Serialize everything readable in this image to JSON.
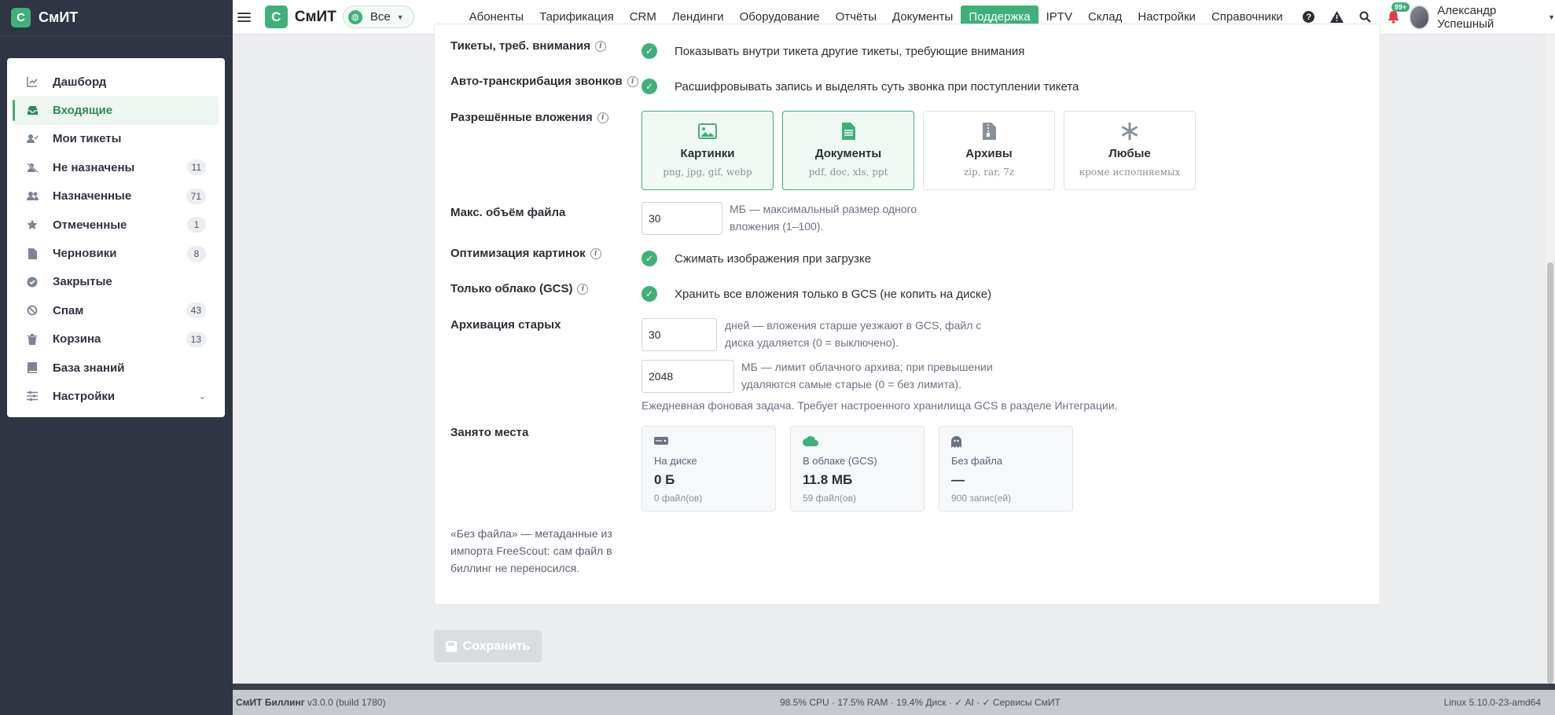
{
  "app": {
    "brand": "СмИТ",
    "logo_letter": "С"
  },
  "sidebar": {
    "items": [
      {
        "label": "Дашборд",
        "icon": "chart-icon"
      },
      {
        "label": "Входящие",
        "icon": "inbox-icon",
        "active": true
      },
      {
        "label": "Мои тикеты",
        "icon": "user-check-icon"
      },
      {
        "label": "Не назначены",
        "icon": "user-slash-icon",
        "count": "11"
      },
      {
        "label": "Назначенные",
        "icon": "users-icon",
        "count": "71"
      },
      {
        "label": "Отмеченные",
        "icon": "star-icon",
        "count": "1"
      },
      {
        "label": "Черновики",
        "icon": "file-icon",
        "count": "8"
      },
      {
        "label": "Закрытые",
        "icon": "check-circle-icon"
      },
      {
        "label": "Спам",
        "icon": "ban-icon",
        "count": "43"
      },
      {
        "label": "Корзина",
        "icon": "trash-icon",
        "count": "13"
      },
      {
        "label": "База знаний",
        "icon": "book-icon"
      },
      {
        "label": "Настройки",
        "icon": "sliders-icon"
      }
    ]
  },
  "topbar": {
    "scope": "Все",
    "nav": [
      "Абоненты",
      "Тарификация",
      "CRM",
      "Лендинги",
      "Оборудование",
      "Отчёты",
      "Документы",
      "Поддержка",
      "IPTV",
      "Склад",
      "Настройки",
      "Справочники"
    ],
    "active_nav": "Поддержка",
    "notifications": "99+",
    "user": "Александр Успешный"
  },
  "form": {
    "tickets_attention": {
      "label": "Тикеты, треб. внимания",
      "text": "Показывать внутри тикета другие тикеты, требующие внимания"
    },
    "transcription": {
      "label": "Авто-транскрибация звонков",
      "text": "Расшифровывать запись и выделять суть звонка при поступлении тикета"
    },
    "attachments": {
      "label": "Разрешённые вложения",
      "types": [
        {
          "title": "Картинки",
          "sub": "png, jpg, gif, webp",
          "selected": true
        },
        {
          "title": "Документы",
          "sub": "pdf, doc, xls, ppt",
          "selected": true
        },
        {
          "title": "Архивы",
          "sub": "zip, rar, 7z",
          "selected": false
        },
        {
          "title": "Любые",
          "sub": "кроме исполняемых",
          "selected": false
        }
      ]
    },
    "max_size": {
      "label": "Макс. объём файла",
      "value": "30",
      "help": "МБ — максимальный размер одного вложения (1–100)."
    },
    "image_opt": {
      "label": "Оптимизация картинок",
      "text": "Сжимать изображения при загрузке"
    },
    "cloud_only": {
      "label": "Только облако (GCS)",
      "text": "Хранить все вложения только в GCS (не копить на диске)"
    },
    "archive": {
      "label": "Архивация старых",
      "days_value": "30",
      "days_help": "дней — вложения старше уезжают в GCS, файл с диска удаляется (0 = выключено).",
      "limit_value": "2048",
      "limit_help": "МБ — лимит облачного архива; при превышении удаляются самые старые (0 = без лимита).",
      "note": "Ежедневная фоновая задача. Требует настроенного хранилища GCS в разделе Интеграции."
    },
    "usage": {
      "label": "Занято места",
      "cards": [
        {
          "label": "На диске",
          "value": "0 Б",
          "sub": "0 файл(ов)",
          "icon": "hdd-icon"
        },
        {
          "label": "В облаке (GCS)",
          "value": "11.8 МБ",
          "sub": "59 файл(ов)",
          "icon": "cloud-icon"
        },
        {
          "label": "Без файла",
          "value": "—",
          "sub": "900 запис(ей)",
          "icon": "ghost-icon"
        }
      ],
      "note": "«Без файла» — метаданные из импорта FreeScout: сам файл в биллинг не переносился."
    },
    "save": "Сохранить"
  },
  "footer": {
    "product": "СмИТ Биллинг",
    "version": "v3.0.0 (build 1780)",
    "stats": "98.5% CPU · 17.5% RAM · 19.4% Диск · ✓ AI · ✓ Сервисы СмИТ",
    "os": "Linux 5.10.0-23-amd64"
  },
  "colors": {
    "accent": "#3fb07a",
    "sidebar_bg": "#2f3542"
  }
}
